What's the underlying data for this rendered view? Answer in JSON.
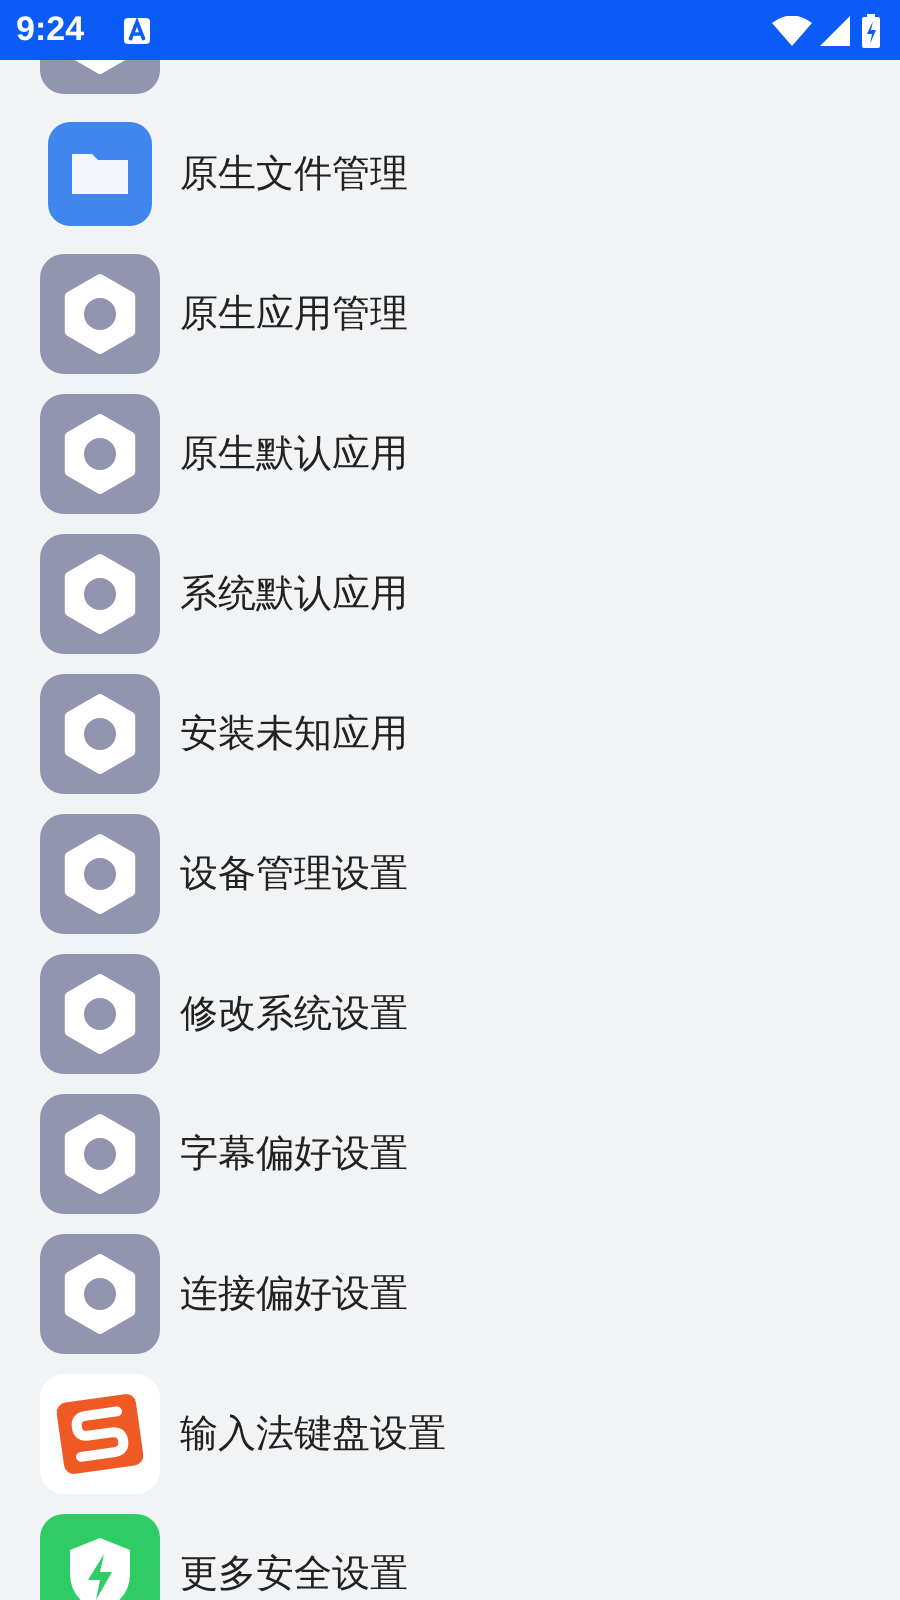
{
  "status_bar": {
    "time": "9:24"
  },
  "items": [
    {
      "kind": "gear"
    },
    {
      "kind": "folder",
      "label": "原生文件管理"
    },
    {
      "kind": "gear",
      "label": "原生应用管理"
    },
    {
      "kind": "gear",
      "label": "原生默认应用"
    },
    {
      "kind": "gear",
      "label": "系统默认应用"
    },
    {
      "kind": "gear",
      "label": "安装未知应用"
    },
    {
      "kind": "gear",
      "label": "设备管理设置"
    },
    {
      "kind": "gear",
      "label": "修改系统设置"
    },
    {
      "kind": "gear",
      "label": "字幕偏好设置"
    },
    {
      "kind": "gear",
      "label": "连接偏好设置"
    },
    {
      "kind": "input",
      "label": "输入法键盘设置"
    },
    {
      "kind": "shield",
      "label": "更多安全设置"
    }
  ]
}
